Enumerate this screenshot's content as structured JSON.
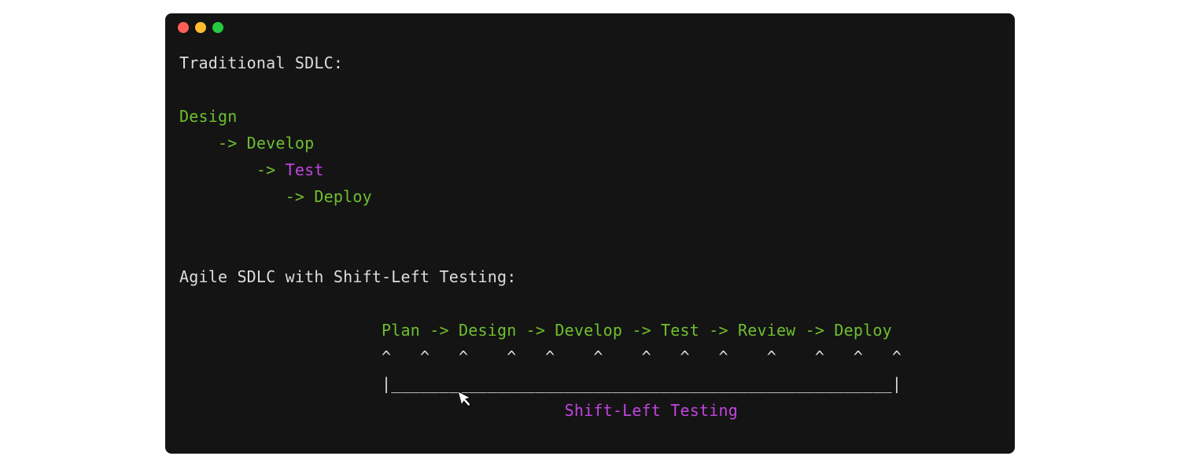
{
  "colors": {
    "background_terminal": "#141414",
    "background_page": "#ffffff",
    "traffic_red": "#ff5f56",
    "traffic_yellow": "#ffbd2e",
    "traffic_green": "#27c93f",
    "text_default": "#e6e6e6",
    "text_green": "#6fbf2f",
    "text_magenta": "#c144e0"
  },
  "terminal": {
    "section1_title": "Traditional SDLC:",
    "section1_line1": "Design",
    "section1_line2": "    -> Develop",
    "section1_line3_prefix": "        -> ",
    "section1_line3_highlight": "Test",
    "section1_line4": "           -> Deploy",
    "section2_title": "Agile SDLC with Shift-Left Testing:",
    "section2_flow": "                     Plan -> Design -> Develop -> Test -> Review -> Deploy",
    "section2_carets": "                     ^   ^   ^    ^   ^    ^    ^   ^   ^    ^    ^   ^   ^",
    "section2_underline": "                     |____________________________________________________|",
    "section2_label": "                                        Shift-Left Testing"
  }
}
